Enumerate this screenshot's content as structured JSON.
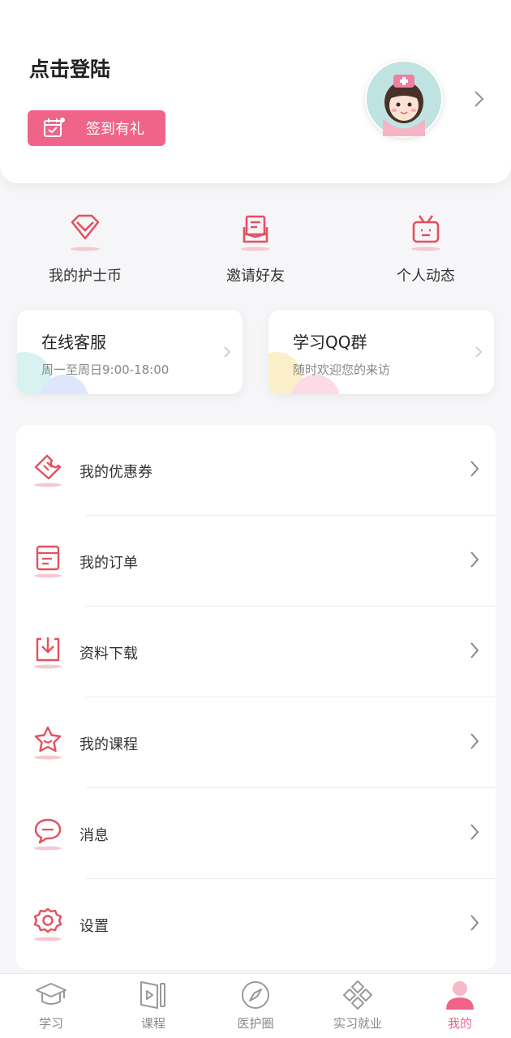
{
  "header": {
    "login_text": "点击登陆",
    "checkin_label": "签到有礼"
  },
  "quick_actions": [
    {
      "label": "我的护士币",
      "icon": "diamond-icon"
    },
    {
      "label": "邀请好友",
      "icon": "envelope-icon"
    },
    {
      "label": "个人动态",
      "icon": "tv-icon"
    }
  ],
  "service_cards": [
    {
      "title": "在线客服",
      "subtitle": "周一至周日9:00-18:00"
    },
    {
      "title": "学习QQ群",
      "subtitle": "随时欢迎您的来访"
    }
  ],
  "menu": [
    {
      "label": "我的优惠券",
      "icon": "coupon-icon"
    },
    {
      "label": "我的订单",
      "icon": "order-icon"
    },
    {
      "label": "资料下载",
      "icon": "download-icon"
    },
    {
      "label": "我的课程",
      "icon": "star-icon"
    },
    {
      "label": "消息",
      "icon": "message-icon"
    },
    {
      "label": "设置",
      "icon": "gear-icon"
    }
  ],
  "tabs": [
    {
      "label": "学习",
      "icon": "graduation-cap-icon",
      "active": false
    },
    {
      "label": "课程",
      "icon": "video-book-icon",
      "active": false
    },
    {
      "label": "医护圈",
      "icon": "compass-icon",
      "active": false
    },
    {
      "label": "实习就业",
      "icon": "network-icon",
      "active": false
    },
    {
      "label": "我的",
      "icon": "person-icon",
      "active": true
    }
  ],
  "colors": {
    "accent": "#f0648a",
    "icon_red": "#e5505f",
    "background": "#f6f6f8"
  }
}
